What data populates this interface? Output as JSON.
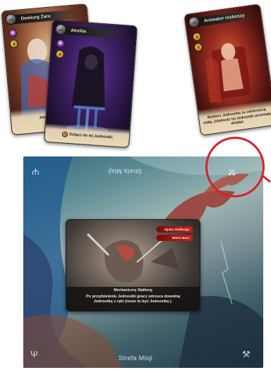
{
  "cards": {
    "demiurg": {
      "name": "Demiurg Żaru",
      "text_line1": "Jeśli zwycięży",
      "text_line2": "do"
    },
    "akolita": {
      "name": "Akolita",
      "text": "Dołącz   do tej Jednostki."
    },
    "animator": {
      "name": "Animator rozkoszy",
      "text_line1": "Wybierz Jednostkę ze zdolnością",
      "text_line2": "stałą. Zdolność tej Jednostki przestaje",
      "text_line3": "działać."
    }
  },
  "board": {
    "top_zone_label": "Strefa Misji",
    "bottom_zone_label": "Strefa Misji"
  },
  "mission_card": {
    "tag1": "Zguba Stalkorga",
    "tag2": "Mistrz Burz",
    "name": "Mechaniczny Stalkorg",
    "text_line1": "Po przydzieleniu Jednostki gracz odrzuca dowolną",
    "text_line2": "Jednostkę z ręki (może to być Jednostka   )."
  },
  "colors": {
    "highlight": "#d8202a",
    "ribbon": "#1a1a1a",
    "tag_red": "#b21a18",
    "card_text_bg": "#ead9b4"
  },
  "icons": {
    "emblem": "skull-emblem-icon",
    "token_purple": "pentagram-icon",
    "token_gold": "crown-icon",
    "board_corner": "trident-icon"
  }
}
